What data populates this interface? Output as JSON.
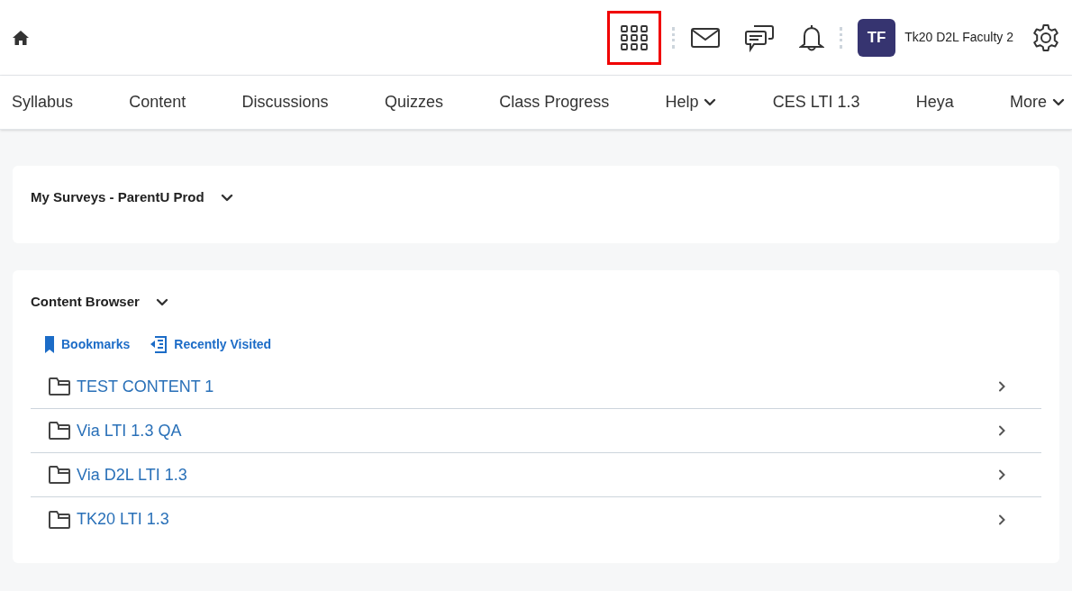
{
  "header": {
    "apps_highlighted": true,
    "user": {
      "initials": "TF",
      "name": "Tk20 D2L Faculty 2"
    }
  },
  "nav": [
    {
      "label": "Syllabus",
      "has_menu": false
    },
    {
      "label": "Content",
      "has_menu": false
    },
    {
      "label": "Discussions",
      "has_menu": false
    },
    {
      "label": "Quizzes",
      "has_menu": false
    },
    {
      "label": "Class Progress",
      "has_menu": false
    },
    {
      "label": "Help",
      "has_menu": true
    },
    {
      "label": "CES LTI 1.3",
      "has_menu": false
    },
    {
      "label": "Heya",
      "has_menu": false
    },
    {
      "label": "More",
      "has_menu": true
    }
  ],
  "widgets": [
    {
      "title": "My Surveys - ParentU Prod"
    },
    {
      "title": "Content Browser",
      "links": [
        "Bookmarks",
        "Recently Visited"
      ],
      "items": [
        {
          "label": "TEST CONTENT 1"
        },
        {
          "label": "Via LTI 1.3 QA"
        },
        {
          "label": "Via D2L LTI 1.3"
        },
        {
          "label": "TK20 LTI 1.3"
        }
      ]
    }
  ]
}
